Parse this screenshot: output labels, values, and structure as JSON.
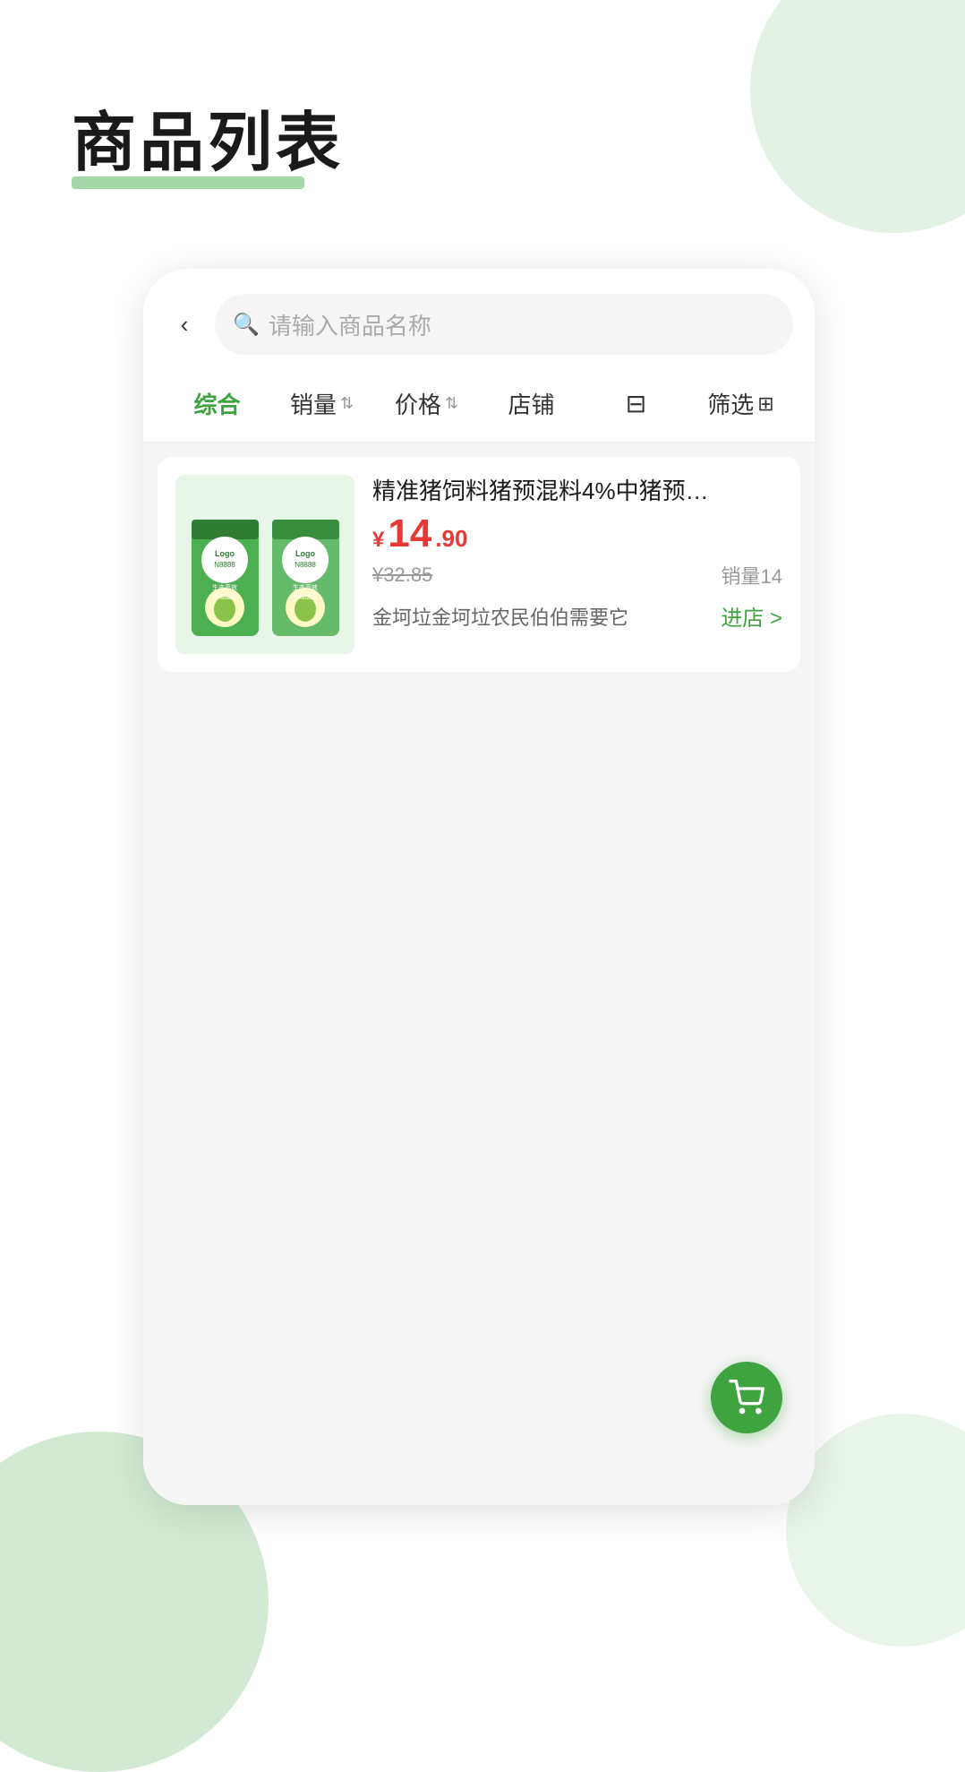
{
  "page": {
    "title": "商品列表",
    "background_color": "#ffffff"
  },
  "search": {
    "placeholder": "请输入商品名称",
    "back_label": "‹"
  },
  "filter_tabs": [
    {
      "id": "comprehensive",
      "label": "综合",
      "active": true,
      "has_sort": false
    },
    {
      "id": "sales",
      "label": "销量",
      "active": false,
      "has_sort": true
    },
    {
      "id": "price",
      "label": "价格",
      "active": false,
      "has_sort": true
    },
    {
      "id": "shop",
      "label": "店铺",
      "active": false,
      "has_sort": false
    },
    {
      "id": "layout",
      "label": "⊟",
      "active": false,
      "has_sort": false
    },
    {
      "id": "filter",
      "label": "筛选",
      "active": false,
      "has_sort": false
    }
  ],
  "products": [
    {
      "id": 1,
      "name": "精准猪饲料猪预混料4%中猪预…",
      "price_main": "14",
      "price_decimal": ".90",
      "price_currency": "¥",
      "price_original": "¥32.85",
      "sales_label": "销量",
      "sales_count": "14",
      "shop_name": "金坷垃金坷垃农民伯伯需要它",
      "enter_shop_label": "进店 >"
    }
  ],
  "cart": {
    "icon": "🛒"
  }
}
